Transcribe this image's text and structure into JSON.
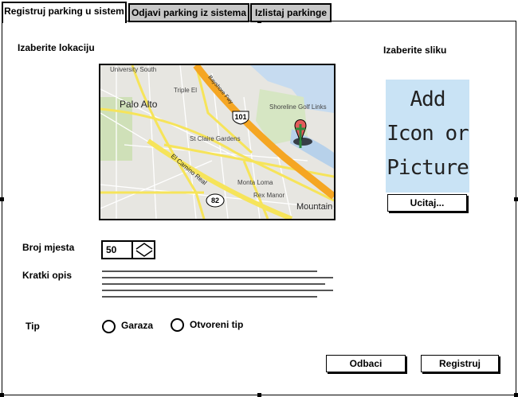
{
  "tabs": [
    {
      "label": "Registruj parking u sistem",
      "active": true
    },
    {
      "label": "Odjavi parking iz sistema",
      "active": false
    },
    {
      "label": "Izlistaj parkinge",
      "active": false
    }
  ],
  "location": {
    "label": "Izaberite lokaciju"
  },
  "map": {
    "places": [
      "University South",
      "Palo Alto",
      "Triple El",
      "Bayshore Fwy",
      "Shoreline Golf Links",
      "St Claire Gardens",
      "El Camino Real",
      "Monta Loma",
      "Rex Manor",
      "Mountain View"
    ],
    "highways": [
      "101",
      "82"
    ],
    "marker_icon": "map-pin-icon"
  },
  "image": {
    "label": "Izaberite sliku",
    "placeholder_lines": [
      "Add",
      "Icon or",
      "Picture"
    ],
    "upload_label": "Ucitaj..."
  },
  "spots": {
    "label": "Broj mjesta",
    "value": "50"
  },
  "description": {
    "label": "Kratki opis"
  },
  "type": {
    "label": "Tip",
    "options": [
      "Garaza",
      "Otvoreni tip"
    ]
  },
  "actions": {
    "cancel_label": "Odbaci",
    "submit_label": "Registruj"
  }
}
